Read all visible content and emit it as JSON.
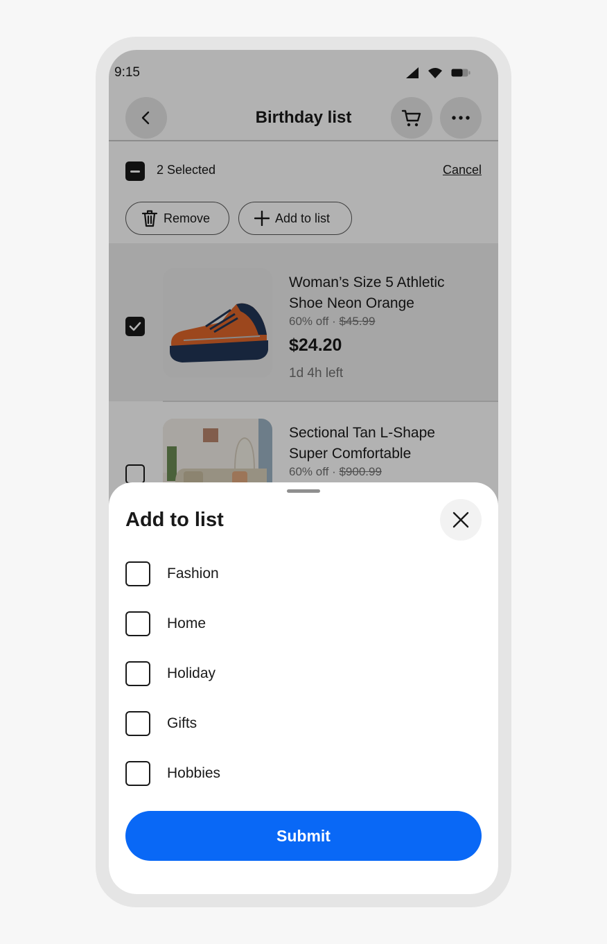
{
  "status_bar": {
    "time": "9:15"
  },
  "header": {
    "title": "Birthday list"
  },
  "selection": {
    "count_label": "2 Selected",
    "cancel_label": "Cancel"
  },
  "actions": {
    "remove_label": "Remove",
    "add_label": "Add to list"
  },
  "items": [
    {
      "title": "Woman’s Size 5 Athletic Shoe Neon Orange",
      "discount": "60% off ·",
      "original_price": "$45.99",
      "price": "$24.20",
      "time_left": "1d 4h left",
      "selected": true
    },
    {
      "title": "Sectional Tan L-Shape Super Comfortable",
      "discount": "60% off ·",
      "original_price": "$900.99",
      "selected": false
    }
  ],
  "sheet": {
    "title": "Add to list",
    "options": [
      {
        "label": "Fashion",
        "checked": false
      },
      {
        "label": "Home",
        "checked": false
      },
      {
        "label": "Holiday",
        "checked": false
      },
      {
        "label": "Gifts",
        "checked": false
      },
      {
        "label": "Hobbies",
        "checked": false
      }
    ],
    "submit_label": "Submit"
  },
  "colors": {
    "primary": "#0968f6",
    "text": "#191919",
    "muted": "#707070"
  }
}
